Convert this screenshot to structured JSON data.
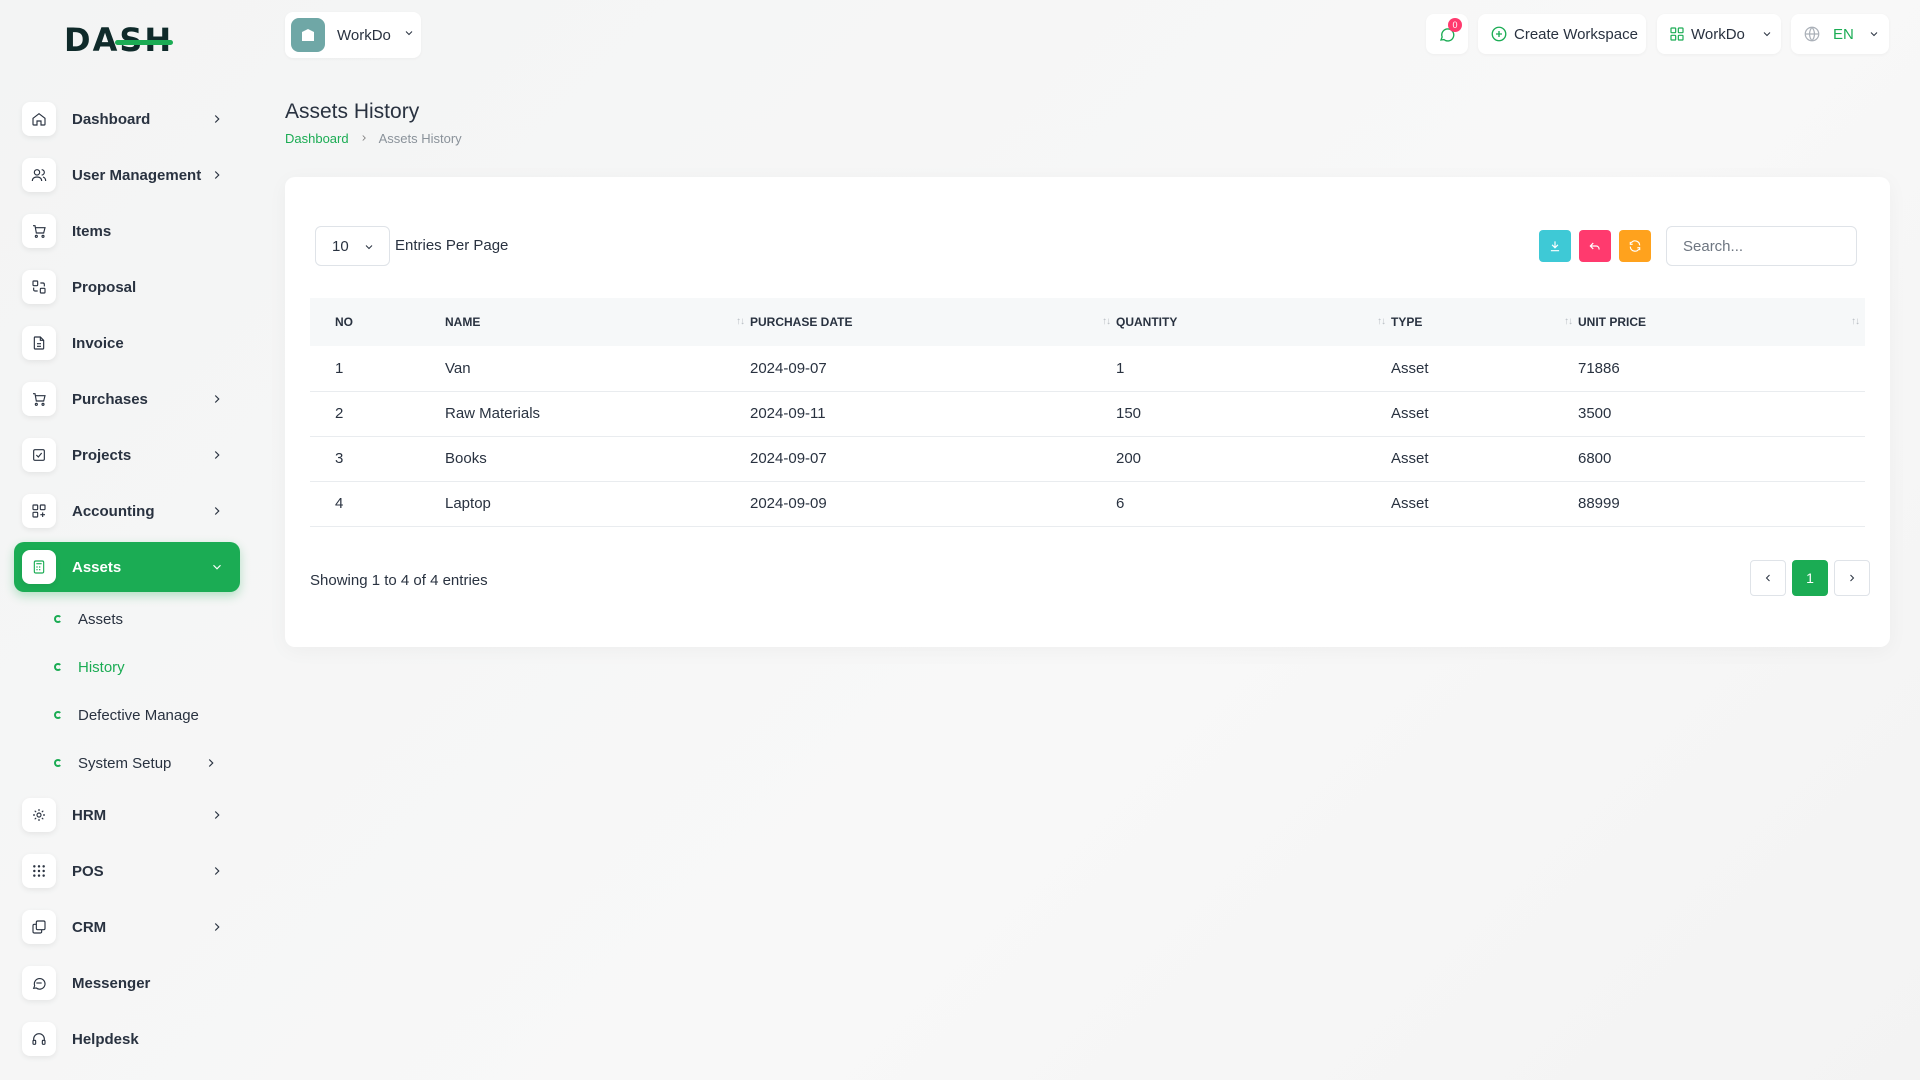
{
  "brand": {
    "logo_text": "DASH"
  },
  "sidebar": {
    "items": [
      {
        "label": "Dashboard",
        "icon": "home-icon",
        "has_children": true
      },
      {
        "label": "User Management",
        "icon": "users-icon",
        "has_children": true
      },
      {
        "label": "Items",
        "icon": "cart-icon",
        "has_children": false
      },
      {
        "label": "Proposal",
        "icon": "proposal-icon",
        "has_children": false
      },
      {
        "label": "Invoice",
        "icon": "file-icon",
        "has_children": false
      },
      {
        "label": "Purchases",
        "icon": "cart-icon",
        "has_children": true
      },
      {
        "label": "Projects",
        "icon": "checklist-icon",
        "has_children": true
      },
      {
        "label": "Accounting",
        "icon": "grid-icon",
        "has_children": true
      },
      {
        "label": "Assets",
        "icon": "calculator-icon",
        "has_children": true,
        "active": true
      }
    ],
    "assets_sub": [
      {
        "label": "Assets"
      },
      {
        "label": "History",
        "active": true
      },
      {
        "label": "Defective Manage"
      },
      {
        "label": "System Setup",
        "has_children": true
      }
    ],
    "items_after": [
      {
        "label": "HRM",
        "icon": "hrm-icon",
        "has_children": true
      },
      {
        "label": "POS",
        "icon": "dots-grid-icon",
        "has_children": true
      },
      {
        "label": "CRM",
        "icon": "crm-icon",
        "has_children": true
      },
      {
        "label": "Messenger",
        "icon": "chat-icon",
        "has_children": false
      },
      {
        "label": "Helpdesk",
        "icon": "headset-icon",
        "has_children": false
      }
    ]
  },
  "header": {
    "workspace_name": "WorkDo",
    "message_count": "0",
    "create_workspace_label": "Create Workspace",
    "workdo_label": "WorkDo",
    "language": "EN"
  },
  "page": {
    "title": "Assets History",
    "breadcrumb": {
      "home": "Dashboard",
      "current": "Assets History"
    }
  },
  "table_controls": {
    "per_page_value": "10",
    "per_page_label": "Entries Per Page",
    "search_placeholder": "Search..."
  },
  "table": {
    "columns": [
      "NO",
      "NAME",
      "PURCHASE DATE",
      "QUANTITY",
      "TYPE",
      "UNIT PRICE"
    ],
    "rows": [
      {
        "no": "1",
        "name": "Van",
        "date": "2024-09-07",
        "qty": "1",
        "type": "Asset",
        "price": "71886"
      },
      {
        "no": "2",
        "name": "Raw Materials",
        "date": "2024-09-11",
        "qty": "150",
        "type": "Asset",
        "price": "3500"
      },
      {
        "no": "3",
        "name": "Books",
        "date": "2024-09-07",
        "qty": "200",
        "type": "Asset",
        "price": "6800"
      },
      {
        "no": "4",
        "name": "Laptop",
        "date": "2024-09-09",
        "qty": "6",
        "type": "Asset",
        "price": "88999"
      }
    ]
  },
  "footer": {
    "showing_text": "Showing 1 to 4 of 4 entries",
    "current_page": "1"
  },
  "colors": {
    "accent": "#1bac54",
    "download": "#3ec9d6",
    "undo": "#ff3a6e",
    "refresh": "#ffa21d"
  }
}
